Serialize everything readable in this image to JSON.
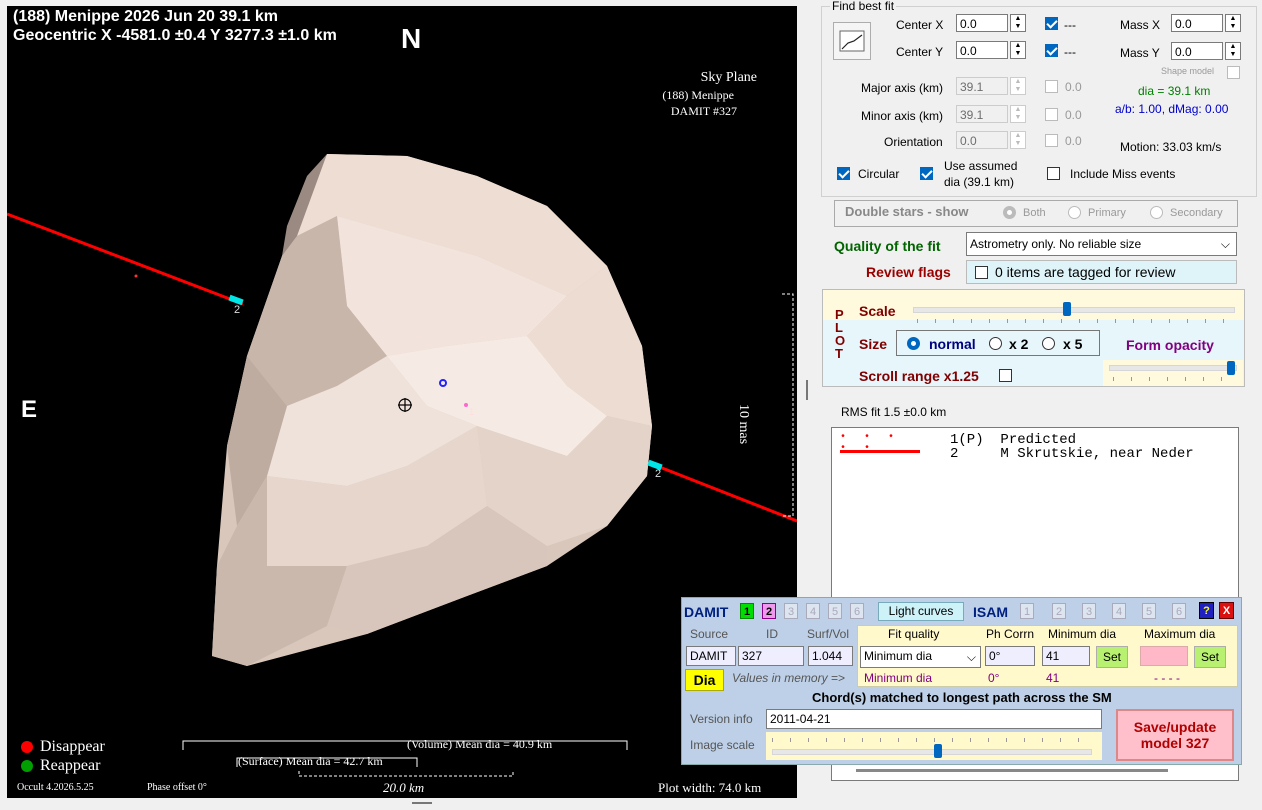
{
  "plot": {
    "title_line1": "(188) Menippe  2026 Jun 20   39.1 km",
    "title_line2": "Geocentric  X  -4581.0 ±0.4  Y 3277.3 ±1.0 km",
    "north": "N",
    "east": "E",
    "sky_plane": [
      "Sky Plane",
      "(188) Menippe",
      "DAMIT #327"
    ],
    "scale_label": "10 mas",
    "legend_disappear": "Disappear",
    "legend_reappear": "Reappear",
    "volume_mean": "(Volume) Mean dia = 40.9 km",
    "surface_mean": "(Surface) Mean dia = 42.7 km",
    "km_scale": "20.0 km",
    "version": "Occult 4.2026.5.25",
    "phase_offset": "Phase offset 0°",
    "plot_width": "Plot width: 74.0 km",
    "chord1_label": "1",
    "chord2_label_top": "2",
    "chord2_label_bottom": "2",
    "colors": {
      "disappear": "#ff0000",
      "reappear": "#00a000",
      "chord": "#ff0000",
      "shape": "#e8d6cc"
    }
  },
  "fit": {
    "group_title": "Find best fit",
    "center_x_label": "Center X",
    "center_x": "0.0",
    "center_y_label": "Center Y",
    "center_y": "0.0",
    "cx_check": "---",
    "cy_check": "---",
    "mass_x_label": "Mass X",
    "mass_x": "0.0",
    "mass_y_label": "Mass Y",
    "mass_y": "0.0",
    "shape_model": "Shape model",
    "major_label": "Major axis (km)",
    "major": "39.1",
    "minor_label": "Minor axis (km)",
    "minor": "39.1",
    "orient_label": "Orientation",
    "orient": "0.0",
    "major_unc": "0.0",
    "minor_unc": "0.0",
    "orient_unc": "0.0",
    "dia_text": "dia = 39.1 km",
    "ab_text": "a/b: 1.00, dMag: 0.00",
    "motion": "Motion: 33.03 km/s",
    "circular": "Circular",
    "use_assumed": "Use assumed",
    "use_assumed2": "dia (39.1 km)",
    "include_miss": "Include Miss events",
    "double_stars": "Double stars - show",
    "both": "Both",
    "primary": "Primary",
    "secondary": "Secondary",
    "quality_label": "Quality of the fit",
    "quality_value": "Astrometry only. No reliable size",
    "review_label": "Review flags",
    "review_value": "0 items are tagged for review"
  },
  "plotbox": {
    "vert": [
      "P",
      "L",
      "O",
      "T"
    ],
    "scale": "Scale",
    "size": "Size",
    "normal": "normal",
    "x2": "x 2",
    "x5": "x 5",
    "form_opacity": "Form opacity",
    "scroll_range": "Scroll range x1.25"
  },
  "rms": "RMS fit  1.5 ±0.0 km",
  "list": [
    {
      "num": "1(P)",
      "name": "Predicted"
    },
    {
      "num": "2",
      "name": "M Skrutskie, near Neder"
    }
  ],
  "damit": {
    "title": "DAMIT",
    "nums": [
      "1",
      "2",
      "3",
      "4",
      "5",
      "6"
    ],
    "light_curves": "Light curves",
    "isam": "ISAM",
    "isam_nums": [
      "1",
      "2",
      "3",
      "4",
      "5",
      "6"
    ],
    "help": "?",
    "close": "X",
    "source_h": "Source",
    "id_h": "ID",
    "surf_h": "Surf/Vol",
    "fitq_h": "Fit quality",
    "phcorr_h": "Ph Corrn",
    "mindia_h": "Minimum dia",
    "maxdia_h": "Maximum dia",
    "source": "DAMIT",
    "id": "327",
    "surf": "1.044",
    "fitq": "Minimum dia",
    "phcorr": "0°",
    "mindia": "41",
    "set": "Set",
    "maxdia": "",
    "dia_btn": "Dia",
    "values_mem": "Values in memory =>",
    "mem_fitq": "Minimum dia",
    "mem_ph": "0°",
    "mem_min": "41",
    "mem_max": "- - - -",
    "chords_matched": "Chord(s) matched to longest path across the SM",
    "version_label": "Version info",
    "version": "2011-04-21",
    "image_scale": "Image scale",
    "save": "Save/update model 327"
  }
}
